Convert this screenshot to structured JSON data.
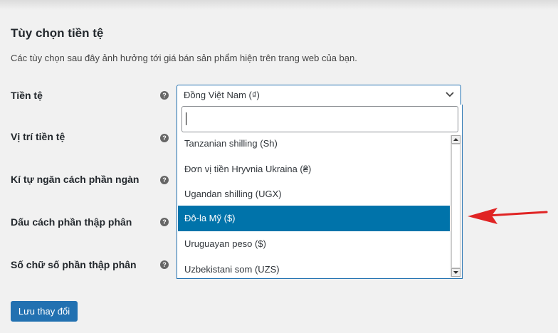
{
  "section": {
    "title": "Tùy chọn tiền tệ",
    "description": "Các tùy chọn sau đây ảnh hưởng tới giá bán sản phẩm hiện trên trang web của bạn."
  },
  "rows": [
    {
      "label": "Tiền tệ"
    },
    {
      "label": "Vị trí tiền tệ"
    },
    {
      "label": "Kí tự ngăn cách phần ngàn"
    },
    {
      "label": "Dấu cách phần thập phân"
    },
    {
      "label": "Số chữ số phần thập phân"
    }
  ],
  "help_icon": {
    "glyph": "?",
    "icon": "help-icon"
  },
  "currency_select": {
    "value": "Đồng Việt Nam (₫)",
    "search_value": "",
    "options": [
      {
        "label": "Tanzanian shilling (Sh)"
      },
      {
        "label": "Đơn vị tiền Hryvnia Ukraina (₴)"
      },
      {
        "label": "Ugandan shilling (UGX)"
      },
      {
        "label": "Đô-la Mỹ ($)",
        "highlighted": true
      },
      {
        "label": "Uruguayan peso ($)"
      },
      {
        "label": "Uzbekistani som (UZS)"
      }
    ]
  },
  "save_button": {
    "label": "Lưu thay đổi"
  },
  "colors": {
    "primary": "#2271b1",
    "highlight": "#0073aa",
    "annotation_arrow": "#e02424"
  }
}
